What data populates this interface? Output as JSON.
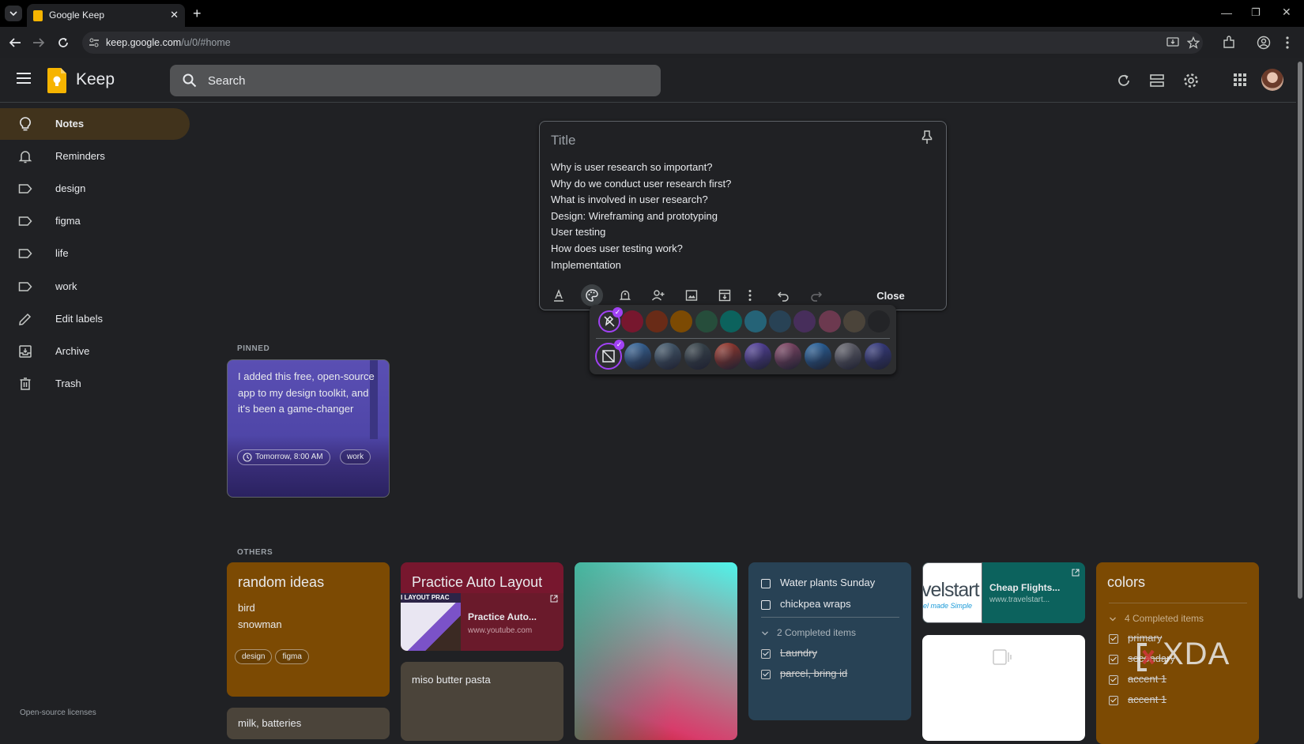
{
  "browser": {
    "tab_title": "Google Keep",
    "url_host": "keep.google.com",
    "url_path": "/u/0/#home"
  },
  "header": {
    "app_name": "Keep",
    "search_placeholder": "Search"
  },
  "sidebar": {
    "items": [
      {
        "label": "Notes",
        "icon": "lightbulb-icon",
        "active": true
      },
      {
        "label": "Reminders",
        "icon": "bell-icon"
      },
      {
        "label": "design",
        "icon": "label-icon"
      },
      {
        "label": "figma",
        "icon": "label-icon"
      },
      {
        "label": "life",
        "icon": "label-icon"
      },
      {
        "label": "work",
        "icon": "label-icon"
      },
      {
        "label": "Edit labels",
        "icon": "pencil-icon"
      },
      {
        "label": "Archive",
        "icon": "archive-icon"
      },
      {
        "label": "Trash",
        "icon": "trash-icon"
      }
    ],
    "footer": "Open-source licenses"
  },
  "editor": {
    "title_placeholder": "Title",
    "lines": [
      "Why is user research so important?",
      "Why do we conduct user research first?",
      "What is involved in user research?",
      "Design: Wireframing and prototyping",
      "User testing",
      "How does user testing work?",
      "Implementation"
    ],
    "close_label": "Close"
  },
  "palette": {
    "colors": [
      "#77172e",
      "#692b17",
      "#7c4a03",
      "#264d3b",
      "#0c625d",
      "#256377",
      "#284255",
      "#472e5b",
      "#6c394f",
      "#4b443a",
      "#232427"
    ],
    "backgrounds": [
      "#3a6ea5",
      "#4a6274",
      "#3c4a4f",
      "#a33b2d",
      "#5a45a8",
      "#8a4a6a",
      "#2a6aa8",
      "#6a6a72",
      "#3a3f8a"
    ]
  },
  "sections": {
    "pinned": "PINNED",
    "others": "OTHERS"
  },
  "notes": {
    "pinned_note": {
      "text": "I added this free, open-source app to my design toolkit, and it's been a game-changer",
      "reminder": "Tomorrow, 8:00 AM",
      "label": "work"
    },
    "random_ideas": {
      "title": "random ideas",
      "lines": [
        "bird",
        "snowman"
      ],
      "labels": [
        "design",
        "figma"
      ],
      "color": "#7c4a03"
    },
    "milk": {
      "text": "milk, batteries"
    },
    "practice": {
      "title": "Practice Auto Layout",
      "link_title": "Practice Auto...",
      "link_url": "www.youtube.com",
      "thumb_text": "I LAYOUT PRAC",
      "color": "#77172e"
    },
    "miso": {
      "text": "miso butter pasta"
    },
    "todo": {
      "items": [
        "Water plants Sunday",
        "chickpea wraps"
      ],
      "completed_count": "2 Completed items",
      "completed": [
        "Laundry",
        "parcel, bring id"
      ]
    },
    "flights": {
      "link_title": "Cheap Flights...",
      "link_url": "www.travelstart...",
      "thumb_text": "velstart",
      "thumb_sub": "el made Simple"
    },
    "colors": {
      "title": "colors",
      "completed_count": "4 Completed items",
      "completed": [
        "primary",
        "secondary",
        "accent 1",
        "accent 1"
      ]
    }
  },
  "watermark": "XDA"
}
